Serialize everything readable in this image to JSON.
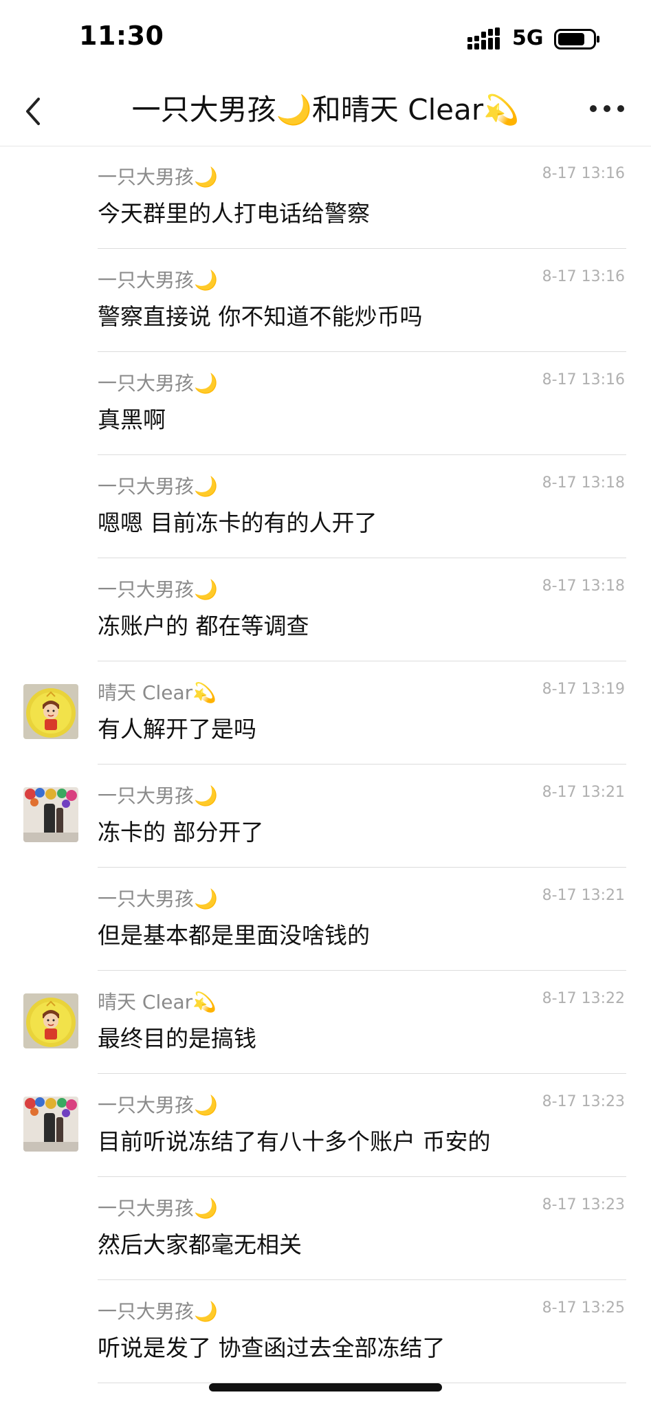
{
  "status_bar": {
    "time": "11:30",
    "network": "5G",
    "signal_icon": "signal-bars-icon",
    "battery_icon": "battery-icon"
  },
  "nav": {
    "title": "一只大男孩🌙和晴天 Clear💫",
    "back_icon": "chevron-left-icon",
    "more_icon": "more-dots-icon"
  },
  "messages": [
    {
      "sender": "一只大男孩🌙",
      "time": "8-17 13:16",
      "text": "今天群里的人打电话给警察",
      "avatar": ""
    },
    {
      "sender": "一只大男孩🌙",
      "time": "8-17 13:16",
      "text": "警察直接说 你不知道不能炒币吗",
      "avatar": ""
    },
    {
      "sender": "一只大男孩🌙",
      "time": "8-17 13:16",
      "text": "真黑啊",
      "avatar": ""
    },
    {
      "sender": "一只大男孩🌙",
      "time": "8-17 13:18",
      "text": "嗯嗯 目前冻卡的有的人开了",
      "avatar": ""
    },
    {
      "sender": "一只大男孩🌙",
      "time": "8-17 13:18",
      "text": "冻账户的 都在等调查",
      "avatar": ""
    },
    {
      "sender": "晴天 Clear💫",
      "time": "8-17 13:19",
      "text": "有人解开了是吗",
      "avatar": "yellow-cartoon-avatar"
    },
    {
      "sender": "一只大男孩🌙",
      "time": "8-17 13:21",
      "text": "冻卡的 部分开了",
      "avatar": "photo-avatar"
    },
    {
      "sender": "一只大男孩🌙",
      "time": "8-17 13:21",
      "text": "但是基本都是里面没啥钱的",
      "avatar": ""
    },
    {
      "sender": "晴天 Clear💫",
      "time": "8-17 13:22",
      "text": "最终目的是搞钱",
      "avatar": "yellow-cartoon-avatar"
    },
    {
      "sender": "一只大男孩🌙",
      "time": "8-17 13:23",
      "text": "目前听说冻结了有八十多个账户 币安的",
      "avatar": "photo-avatar"
    },
    {
      "sender": "一只大男孩🌙",
      "time": "8-17 13:23",
      "text": "然后大家都毫无相关",
      "avatar": ""
    },
    {
      "sender": "一只大男孩🌙",
      "time": "8-17 13:25",
      "text": "听说是发了 协查函过去全部冻结了",
      "avatar": ""
    }
  ]
}
